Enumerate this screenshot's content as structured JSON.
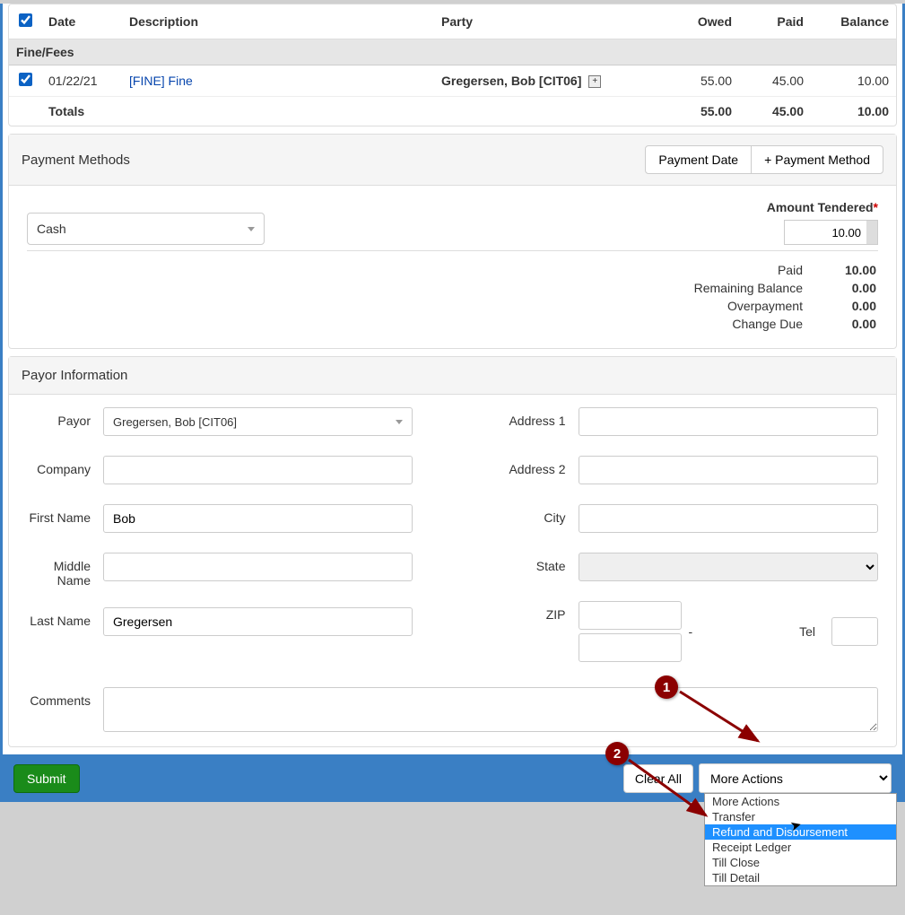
{
  "fee_table": {
    "columns": [
      "",
      "Date",
      "Description",
      "Party",
      "Owed",
      "Paid",
      "Balance"
    ],
    "section_label": "Fine/Fees",
    "row": {
      "date": "01/22/21",
      "description": "[FINE] Fine",
      "party": "Gregersen, Bob [CIT06]",
      "owed": "55.00",
      "paid": "45.00",
      "balance": "10.00"
    },
    "totals": {
      "label": "Totals",
      "owed": "55.00",
      "paid": "45.00",
      "balance": "10.00"
    }
  },
  "payment_methods": {
    "title": "Payment Methods",
    "buttons": {
      "date": "Payment Date",
      "add": "+  Payment Method"
    },
    "method_selected": "Cash",
    "amount_label": "Amount Tendered",
    "amount_value": "10.00",
    "summary": {
      "paid": {
        "label": "Paid",
        "value": "10.00"
      },
      "remaining": {
        "label": "Remaining Balance",
        "value": "0.00"
      },
      "overpayment": {
        "label": "Overpayment",
        "value": "0.00"
      },
      "change": {
        "label": "Change Due",
        "value": "0.00"
      }
    }
  },
  "payor": {
    "title": "Payor Information",
    "labels": {
      "payor": "Payor",
      "company": "Company",
      "first": "First Name",
      "middle": "Middle Name",
      "last": "Last Name",
      "addr1": "Address 1",
      "addr2": "Address 2",
      "city": "City",
      "state": "State",
      "zip": "ZIP",
      "tel": "Tel",
      "comments": "Comments"
    },
    "values": {
      "payor_select": "Gregersen, Bob [CIT06]",
      "company": "",
      "first": "Bob",
      "middle": "",
      "last": "Gregersen",
      "addr1": "",
      "addr2": "",
      "city": "",
      "state": "",
      "zip1": "",
      "zip2": "",
      "tel": "",
      "comments": ""
    },
    "zip_sep": "-"
  },
  "footer": {
    "submit": "Submit",
    "clear": "Clear All",
    "more_label": "More Actions",
    "options": [
      "More Actions",
      "Transfer",
      "Refund and Disbursement",
      "Receipt Ledger",
      "Till Close",
      "Till Detail"
    ],
    "highlighted_index": 2
  },
  "annotations": {
    "callout1": "1",
    "callout2": "2"
  }
}
